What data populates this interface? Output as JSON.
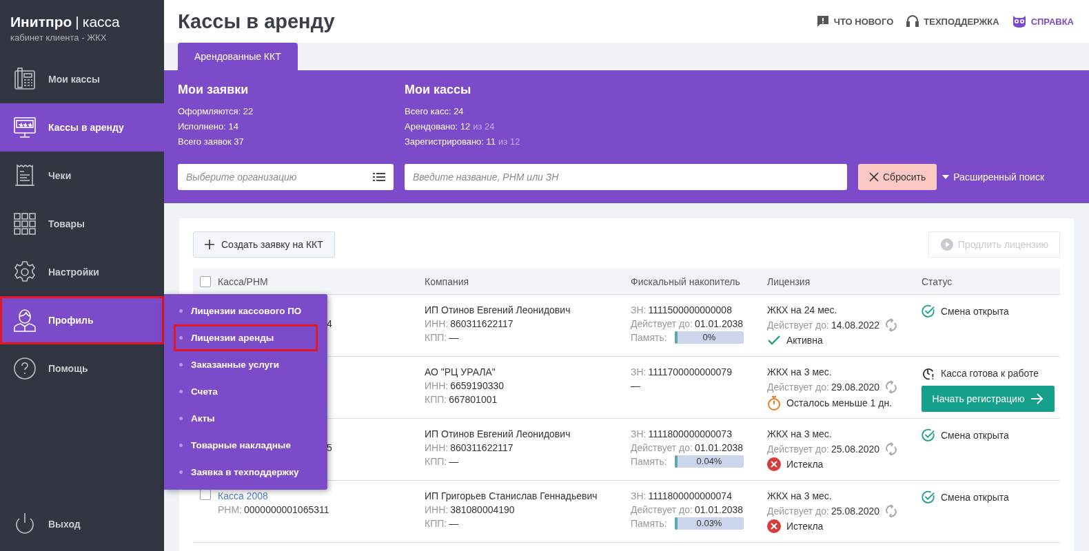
{
  "brand": {
    "name": "Инитпро",
    "separator": "|",
    "product": "касса",
    "subtitle": "кабинет клиента - ЖКХ"
  },
  "sidebar": {
    "items": [
      {
        "label": "Мои кассы",
        "selected": false,
        "highlighted": false
      },
      {
        "label": "Кассы в аренду",
        "selected": true,
        "highlighted": false
      },
      {
        "label": "Чеки",
        "selected": false,
        "highlighted": false
      },
      {
        "label": "Товары",
        "selected": false,
        "highlighted": false
      },
      {
        "label": "Настройки",
        "selected": false,
        "highlighted": false
      },
      {
        "label": "Профиль",
        "selected": true,
        "highlighted": true
      },
      {
        "label": "Помощь",
        "selected": false,
        "highlighted": false
      }
    ],
    "logout": {
      "label": "Выход"
    }
  },
  "profile_menu": [
    {
      "label": "Лицензии кассового ПО",
      "highlighted": false
    },
    {
      "label": "Лицензии аренды",
      "highlighted": true
    },
    {
      "label": "Заказанные услуги",
      "highlighted": false
    },
    {
      "label": "Счета",
      "highlighted": false
    },
    {
      "label": "Акты",
      "highlighted": false
    },
    {
      "label": "Товарные накладные",
      "highlighted": false
    },
    {
      "label": "Заявка в техподдержку",
      "highlighted": false
    }
  ],
  "page": {
    "title": "Кассы в аренду"
  },
  "header_links": [
    {
      "label": "ЧТО НОВОГО",
      "kind": "news"
    },
    {
      "label": "ТЕХПОДДЕРЖКА",
      "kind": "support"
    },
    {
      "label": "СПРАВКА",
      "kind": "help"
    }
  ],
  "tabs": [
    {
      "label": "Арендованные ККТ",
      "selected": true
    }
  ],
  "summary": [
    {
      "title": "Мои заявки",
      "lines": [
        {
          "text": "Оформляются: 22"
        },
        {
          "text": "Исполнено: 14"
        },
        {
          "text": "Всего заявок 37"
        }
      ]
    },
    {
      "title": "Мои кассы",
      "lines": [
        {
          "text": "Всего касс: 24"
        },
        {
          "text": "Арендовано: 12",
          "suffix": "из 24"
        },
        {
          "text": "Зарегистрировано: 11",
          "suffix": "из 12"
        }
      ]
    }
  ],
  "filters": {
    "organization": {
      "placeholder": "Выберите организацию"
    },
    "search": {
      "placeholder": "Введите название, РНМ или ЗН"
    },
    "reset": "Сбросить",
    "advanced": "Расширенный поиск"
  },
  "actions": {
    "create": "Создать заявку на ККТ",
    "extend": {
      "label": "Продлить лицензию",
      "disabled": true
    }
  },
  "table": {
    "header_checkbox": {
      "checked": false
    },
    "columns": [
      "Касса/РНМ",
      "Компания",
      "Фискальный накопитель",
      "Лицензия",
      "Статус"
    ],
    "rows": [
      {
        "cassa_tail": "4",
        "company": {
          "name": "ИП Отинов Евгений Леонидович",
          "fields": [
            {
              "label": "ИНН:",
              "value": "860311622117"
            },
            {
              "label": "КПП:",
              "value": "—"
            }
          ]
        },
        "fn": {
          "fields": [
            {
              "label": "ЗН:",
              "value": "1111500000000008"
            },
            {
              "label": "Действует до:",
              "value": "01.01.2038"
            }
          ],
          "memory": {
            "label": "Память:",
            "level": 0,
            "reading": "0%"
          }
        },
        "license": {
          "title": "ЖКХ на 24 мес.",
          "valid_label": "Действует до:",
          "valid_value": "14.08.2022",
          "state": {
            "kind": "active",
            "text": "Активна"
          }
        },
        "status": {
          "kind": "open",
          "text": "Смена открыта"
        }
      },
      {
        "company": {
          "name": "АО \"РЦ УРАЛА\"",
          "fields": [
            {
              "label": "ИНН:",
              "value": "6659190330"
            },
            {
              "label": "КПП:",
              "value": "667801001"
            }
          ]
        },
        "fn": {
          "fields": [
            {
              "label": "ЗН:",
              "value": "1111700000000079"
            }
          ],
          "note": "—"
        },
        "license": {
          "title": "ЖКХ на 3 мес.",
          "valid_label": "Действует до:",
          "valid_value": "29.08.2020",
          "state": {
            "kind": "warning",
            "text": "Осталось меньше 1 дн."
          }
        },
        "status": {
          "kind": "ready",
          "text": "Касса готова к работе",
          "button": "Начать регистрацию"
        }
      },
      {
        "cassa_tail": "5",
        "company": {
          "name": "ИП Отинов Евгений Леонидович",
          "fields": [
            {
              "label": "ИНН:",
              "value": "860311622117"
            },
            {
              "label": "КПП:",
              "value": "—"
            }
          ]
        },
        "fn": {
          "fields": [
            {
              "label": "ЗН:",
              "value": "1111800000000073"
            },
            {
              "label": "Действует до:",
              "value": "01.01.2038"
            }
          ],
          "memory": {
            "label": "Память:",
            "level": 0.0004,
            "reading": "0.04%"
          }
        },
        "license": {
          "title": "ЖКХ на 3 мес.",
          "valid_label": "Действует до:",
          "valid_value": "25.08.2020",
          "state": {
            "kind": "expired",
            "text": "Истекла"
          }
        },
        "status": {
          "kind": "open",
          "text": "Смена открыта"
        }
      },
      {
        "checkbox": {
          "checked": false
        },
        "cassa": {
          "name": "Касса 2008",
          "rnm_label": "РНМ:",
          "rnm": "0000000001065311"
        },
        "company": {
          "name": "ИП Григорьев Станислав Геннадьевич",
          "fields": [
            {
              "label": "ИНН:",
              "value": "381080004190"
            },
            {
              "label": "КПП:",
              "value": "—"
            }
          ]
        },
        "fn": {
          "fields": [
            {
              "label": "ЗН:",
              "value": "1111800000000074"
            },
            {
              "label": "Действует до:",
              "value": "01.01.2038"
            }
          ],
          "memory": {
            "label": "Память:",
            "level": 0.0003,
            "reading": "0.03%"
          }
        },
        "license": {
          "title": "ЖКХ на 3 мес.",
          "valid_label": "Действует до:",
          "valid_value": "25.08.2020",
          "state": {
            "kind": "expired",
            "text": "Истекла"
          }
        },
        "status": {
          "kind": "open",
          "text": "Смена открыта"
        }
      }
    ]
  }
}
